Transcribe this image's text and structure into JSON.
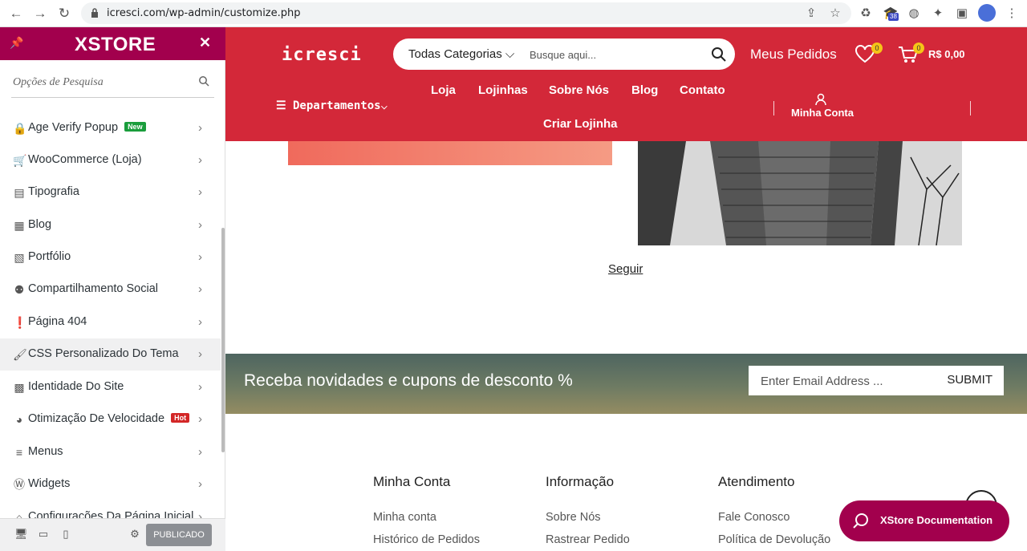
{
  "browser": {
    "url": "icresci.com/wp-admin/customize.php",
    "ext_badge": "38"
  },
  "sidebar": {
    "logo": "XSTORE",
    "search_placeholder": "Opções de Pesquisa",
    "items": [
      {
        "label": "Age Verify Popup",
        "icon": "lock-icon",
        "tag": "New"
      },
      {
        "label": "WooCommerce (Loja)",
        "icon": "cart-icon",
        "tag": ""
      },
      {
        "label": "Tipografia",
        "icon": "document-icon",
        "tag": ""
      },
      {
        "label": "Blog",
        "icon": "grid-icon",
        "tag": ""
      },
      {
        "label": "Portfólio",
        "icon": "image-icon",
        "tag": ""
      },
      {
        "label": "Compartilhamento Social",
        "icon": "share-icon",
        "tag": ""
      },
      {
        "label": "Página 404",
        "icon": "info-icon",
        "tag": ""
      },
      {
        "label": "CSS Personalizado Do Tema",
        "icon": "brush-icon",
        "tag": ""
      },
      {
        "label": "Identidade Do Site",
        "icon": "identity-icon",
        "tag": ""
      },
      {
        "label": "Otimização De Velocidade",
        "icon": "speed-icon",
        "tag": "Hot"
      },
      {
        "label": "Menus",
        "icon": "menu-icon",
        "tag": ""
      },
      {
        "label": "Widgets",
        "icon": "wordpress-icon",
        "tag": ""
      },
      {
        "label": "Configurações Da Página Inicial",
        "icon": "home-icon",
        "tag": ""
      }
    ],
    "publish_label": "PUBLICADO"
  },
  "site": {
    "brand": "icresci",
    "category_select": "Todas Categorias",
    "search_placeholder": "Busque aqui...",
    "orders_link": "Meus Pedidos",
    "wishlist_count": "0",
    "cart_count": "0",
    "cart_total": "R$ 0,00",
    "departments": "Departamentos",
    "nav": [
      "Loja",
      "Lojinhas",
      "Sobre Nós",
      "Blog",
      "Contato",
      "Criar Lojinha"
    ],
    "account": "Minha Conta",
    "follow": "Seguir",
    "newsletter": {
      "text": "Receba novidades e cupons de desconto %",
      "email_placeholder": "Enter Email Address ...",
      "submit": "SUBMIT"
    },
    "footer": {
      "columns": [
        {
          "title": "Minha Conta",
          "links": [
            "Minha conta",
            "Histórico de Pedidos"
          ]
        },
        {
          "title": "Informação",
          "links": [
            "Sobre Nós",
            "Rastrear Pedido"
          ]
        },
        {
          "title": "Atendimento",
          "links": [
            "Fale Conosco",
            "Política de Devolução"
          ]
        }
      ]
    },
    "doc_button": "XStore Documentation"
  }
}
